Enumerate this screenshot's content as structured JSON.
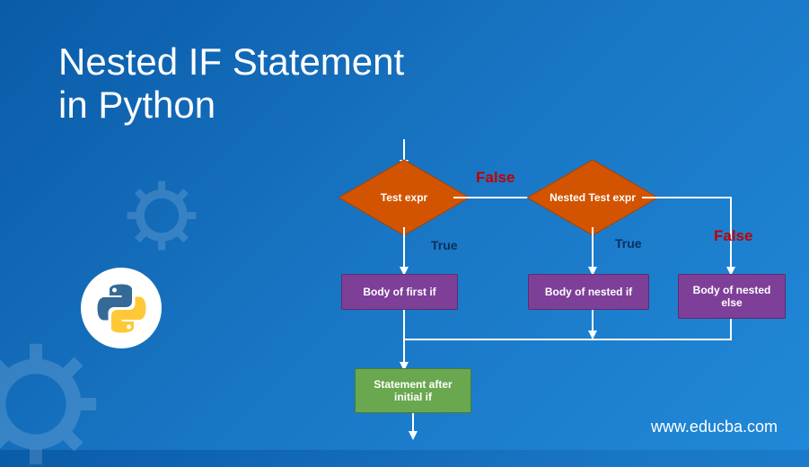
{
  "title_line1": "Nested IF Statement",
  "title_line2": "in Python",
  "website": "www.educba.com",
  "flow": {
    "diamond1": "Test expr",
    "diamond2": "Nested Test  expr",
    "box_first_if": "Body of first if",
    "box_nested_if": "Body of nested if",
    "box_nested_else": "Body of nested else",
    "box_after": "Statement after initial if",
    "label_false1": "False",
    "label_false2": "False",
    "label_true1": "True",
    "label_true2": "True"
  }
}
